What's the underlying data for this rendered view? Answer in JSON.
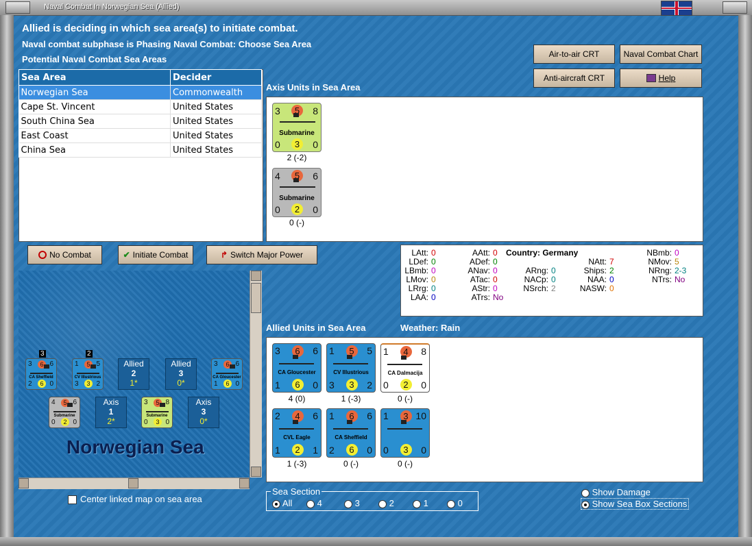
{
  "window": {
    "title": "Naval Combat In Norwegian Sea (Allied)"
  },
  "header": {
    "line1": "Allied is deciding in which sea area(s) to initiate combat.",
    "line2": "Naval combat subphase is Phasing Naval Combat: Choose Sea Area",
    "line3": "Potential Naval Combat Sea Areas"
  },
  "buttons": {
    "air_to_air": "Air-to-air CRT",
    "naval_chart": "Naval Combat Chart",
    "anti_aircraft": "Anti-aircraft CRT",
    "help": "Help",
    "no_combat": "No Combat",
    "initiate_combat": "Initiate Combat",
    "switch_major_power": "Switch Major Power"
  },
  "sea_table": {
    "columns": [
      "Sea Area",
      "Decider"
    ],
    "rows": [
      {
        "area": "Norwegian Sea",
        "decider": "Commonwealth",
        "selected": true
      },
      {
        "area": "Cape St. Vincent",
        "decider": "United States"
      },
      {
        "area": "South China Sea",
        "decider": "United States"
      },
      {
        "area": "East Coast",
        "decider": "United States"
      },
      {
        "area": "China Sea",
        "decider": "United States"
      }
    ]
  },
  "axis_units": {
    "title": "Axis Units in Sea Area",
    "units": [
      {
        "tl": "3",
        "tc": "5",
        "tr": "8",
        "name": "Submarine",
        "bl": "0",
        "bc": "3",
        "br": "0",
        "caption": "2 (-2)",
        "color": "#c8e67a"
      },
      {
        "tl": "4",
        "tc": "5",
        "tr": "6",
        "name": "Submarine",
        "bl": "0",
        "bc": "2",
        "br": "0",
        "caption": "0 (-)",
        "color": "#b9b9b9"
      }
    ]
  },
  "stats": {
    "country_label": "Country: Germany",
    "items": [
      {
        "k": "LAtt:",
        "v": "0",
        "vc": "#d00000"
      },
      {
        "k": "LDef:",
        "v": "0",
        "vc": "#008000"
      },
      {
        "k": "LBmb:",
        "v": "0",
        "vc": "#c000c0"
      },
      {
        "k": "LMov:",
        "v": "0",
        "vc": "#b8860b"
      },
      {
        "k": "LRrg:",
        "v": "0",
        "vc": "#008080"
      },
      {
        "k": "LAA:",
        "v": "0",
        "vc": "#0000c0"
      },
      {
        "k": "AAtt:",
        "v": "0",
        "vc": "#d00000"
      },
      {
        "k": "ADef:",
        "v": "0",
        "vc": "#008000"
      },
      {
        "k": "ANav:",
        "v": "0",
        "vc": "#c000c0"
      },
      {
        "k": "ATac:",
        "v": "0",
        "vc": "#d00000"
      },
      {
        "k": "AStr:",
        "v": "0",
        "vc": "#c000c0"
      },
      {
        "k": "ATrs:",
        "v": "No",
        "vc": "#800080"
      },
      {
        "k": "ARng:",
        "v": "0",
        "vc": "#008080"
      },
      {
        "k": "NACp:",
        "v": "0",
        "vc": "#008080"
      },
      {
        "k": "NSrch:",
        "v": "2",
        "vc": "#808080"
      },
      {
        "k": "NAtt:",
        "v": "7",
        "vc": "#d00000"
      },
      {
        "k": "Ships:",
        "v": "2",
        "vc": "#008000"
      },
      {
        "k": "NAA:",
        "v": "0",
        "vc": "#0000c0"
      },
      {
        "k": "NASW:",
        "v": "0",
        "vc": "#e07000"
      },
      {
        "k": "NBmb:",
        "v": "0",
        "vc": "#c000c0"
      },
      {
        "k": "NMov:",
        "v": "5",
        "vc": "#b8860b"
      },
      {
        "k": "NRng:",
        "v": "2-3",
        "vc": "#008080"
      },
      {
        "k": "NTrs:",
        "v": "No",
        "vc": "#800080"
      }
    ]
  },
  "allied_units": {
    "title": "Allied Units in Sea Area",
    "weather": "Weather:  Rain",
    "units": [
      {
        "tl": "3",
        "tc": "6",
        "tr": "6",
        "name": "CA Gloucester",
        "bl": "1",
        "bc": "6",
        "br": "0",
        "caption": "4 (0)",
        "color": "#2a8fd0"
      },
      {
        "tl": "1",
        "tc": "5",
        "tr": "5",
        "name": "CV Illustrious",
        "bl": "3",
        "bc": "3",
        "br": "2",
        "caption": "1 (-3)",
        "color": "#2a8fd0"
      },
      {
        "tl": "1",
        "tc": "4",
        "tr": "8",
        "name": "CA Dalmacija",
        "bl": "0",
        "bc": "2",
        "br": "0",
        "caption": "0 (-)",
        "color": "#ffffff"
      },
      {
        "tl": "2",
        "tc": "4",
        "tr": "6",
        "name": "CVL Eagle",
        "bl": "1",
        "bc": "2",
        "br": "1",
        "caption": "1 (-3)",
        "color": "#2a8fd0"
      },
      {
        "tl": "1",
        "tc": "6",
        "tr": "6",
        "name": "CA Sheffield",
        "bl": "2",
        "bc": "6",
        "br": "0",
        "caption": "0 (-)",
        "color": "#2a8fd0"
      },
      {
        "tl": "1",
        "tc": "3",
        "tr": "10",
        "name": "",
        "bl": "0",
        "bc": "3",
        "br": "0",
        "caption": "0 (-)",
        "color": "#2a8fd0"
      }
    ]
  },
  "map": {
    "sea_name": "Norwegian Sea",
    "boxes": [
      {
        "side": "Allied",
        "num": "2",
        "sub": "1*"
      },
      {
        "side": "Allied",
        "num": "3",
        "sub": "0*"
      },
      {
        "side": "Axis",
        "num": "1",
        "sub": "2*"
      },
      {
        "side": "Axis",
        "num": "3",
        "sub": "0*"
      }
    ],
    "counters": [
      {
        "name": "CA Sheffield",
        "tl": "3",
        "tc": "6",
        "tr": "6",
        "bl": "2",
        "bc": "6",
        "br": "0",
        "stack": "3"
      },
      {
        "name": "CV Illustrious",
        "tl": "1",
        "tc": "5",
        "tr": "5",
        "bl": "3",
        "bc": "3",
        "br": "2",
        "stack": "2"
      },
      {
        "name": "CA Gloucester",
        "tl": "3",
        "tc": "6",
        "tr": "6",
        "bl": "1",
        "bc": "6",
        "br": "0",
        "stack": ""
      },
      {
        "name": "Submarine",
        "tl": "4",
        "tc": "5",
        "tr": "6",
        "bl": "0",
        "bc": "2",
        "br": "0",
        "stack": ""
      },
      {
        "name": "Submarine",
        "tl": "3",
        "tc": "5",
        "tr": "8",
        "bl": "0",
        "bc": "3",
        "br": "0",
        "stack": ""
      }
    ],
    "center_linked": "Center linked map on sea area"
  },
  "sea_section": {
    "label": "Sea Section",
    "options": [
      "All",
      "4",
      "3",
      "2",
      "1",
      "0"
    ],
    "selected": "All"
  },
  "display_options": {
    "show_damage": "Show Damage",
    "show_sea_box": "Show Sea Box Sections",
    "selected": "Show Sea Box Sections"
  }
}
